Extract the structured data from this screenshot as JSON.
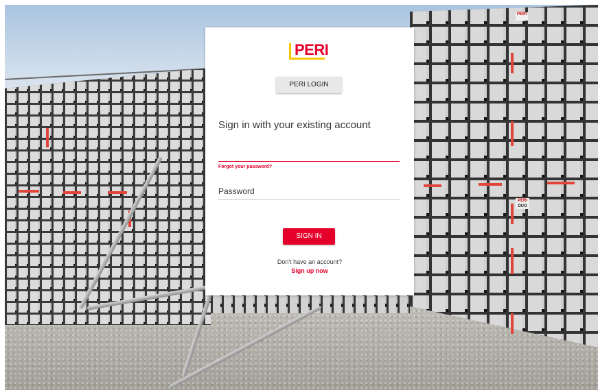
{
  "background": {
    "badge_top": "PERI",
    "badge_right_brand": "PERI",
    "badge_right_model": "DUO"
  },
  "card": {
    "logo_text": "PERI",
    "peri_login_label": "PERI LOGIN",
    "heading": "Sign in with your existing account",
    "email": {
      "value": "",
      "placeholder": ""
    },
    "forgot_password": "Forgot your password?",
    "password": {
      "value": "",
      "placeholder": "Password"
    },
    "sign_in_label": "SIGN IN",
    "no_account_text": "Don't have an account?",
    "sign_up_label": "Sign up now"
  },
  "colors": {
    "brand_red": "#e4002b",
    "brand_yellow": "#f7c600",
    "card_bg": "#ffffff",
    "secondary_button_bg": "#e8e8e8"
  }
}
